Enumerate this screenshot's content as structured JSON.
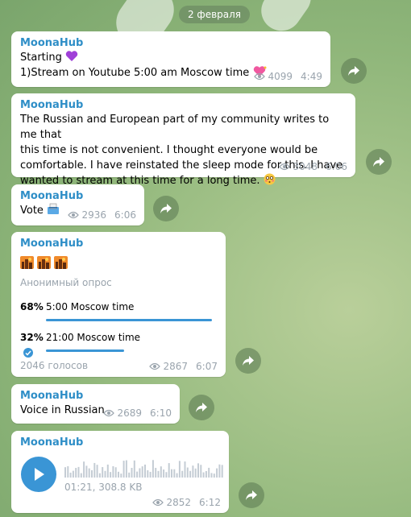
{
  "date_separator": "2 февраля",
  "messages": [
    {
      "author": "MoonaHub",
      "lines": [
        "Starting",
        "1)Stream on Youtube 5:00 am Moscow time"
      ],
      "views": "4099",
      "time": "4:49"
    },
    {
      "author": "MoonaHub",
      "lines": [
        "The Russian and European part of my community writes to me that",
        "this time is not convenient. I thought everyone would be",
        "comfortable. I have reinstated the sleep mode for this. I have",
        "wanted to stream at this time for a long time."
      ],
      "views": "3048",
      "time": "6:06"
    },
    {
      "author": "MoonaHub",
      "text": "Vote",
      "views": "2936",
      "time": "6:06"
    },
    {
      "author": "MoonaHub",
      "poll_type": "Анонимный опрос",
      "options": [
        {
          "percent": "68%",
          "label": "5:00 Moscow time",
          "fraction": 0.68
        },
        {
          "percent": "32%",
          "label": "21:00 Moscow time",
          "fraction": 0.32
        }
      ],
      "votes": "2046 голосов",
      "views": "2867",
      "time": "6:07"
    },
    {
      "author": "MoonaHub",
      "text": "Voice in Russian",
      "views": "2689",
      "time": "6:10"
    },
    {
      "author": "MoonaHub",
      "audio_info": "01:21, 308.8 KB",
      "views": "2852",
      "time": "6:12"
    }
  ],
  "colors": {
    "accent": "#3a95d5",
    "author": "#2e8ec7"
  }
}
